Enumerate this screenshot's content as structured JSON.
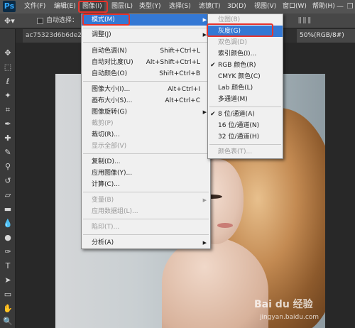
{
  "app": {
    "logo": "Ps"
  },
  "menubar": {
    "items": [
      "文件(F)",
      "编辑(E)",
      "图像(I)",
      "图层(L)",
      "类型(Y)",
      "选择(S)",
      "滤镜(T)",
      "3D(D)",
      "视图(V)",
      "窗口(W)",
      "帮助(H)"
    ],
    "window_controls": [
      "—",
      "❐",
      "✕"
    ]
  },
  "options_bar": {
    "auto_select": "自动选择：",
    "zoom_info": "50%(RGB/8#)"
  },
  "tabs": {
    "doc_name": "ac75323d6b6de24",
    "doc_info": "50%(RGB/8#)",
    "close": "×"
  },
  "image_menu": {
    "items": [
      {
        "label": "模式(M)",
        "shortcut": "",
        "submenu": true,
        "disabled": false
      },
      {
        "label": "调整(J)",
        "shortcut": "",
        "submenu": true,
        "disabled": false
      },
      {
        "label": "自动色调(N)",
        "shortcut": "Shift+Ctrl+L",
        "submenu": false,
        "disabled": false
      },
      {
        "label": "自动对比度(U)",
        "shortcut": "Alt+Shift+Ctrl+L",
        "submenu": false,
        "disabled": false
      },
      {
        "label": "自动颜色(O)",
        "shortcut": "Shift+Ctrl+B",
        "submenu": false,
        "disabled": false
      },
      {
        "label": "图像大小(I)...",
        "shortcut": "Alt+Ctrl+I",
        "submenu": false,
        "disabled": false
      },
      {
        "label": "画布大小(S)...",
        "shortcut": "Alt+Ctrl+C",
        "submenu": false,
        "disabled": false
      },
      {
        "label": "图像旋转(G)",
        "shortcut": "",
        "submenu": true,
        "disabled": false
      },
      {
        "label": "裁剪(P)",
        "shortcut": "",
        "submenu": false,
        "disabled": true
      },
      {
        "label": "裁切(R)...",
        "shortcut": "",
        "submenu": false,
        "disabled": false
      },
      {
        "label": "显示全部(V)",
        "shortcut": "",
        "submenu": false,
        "disabled": true
      },
      {
        "label": "复制(D)...",
        "shortcut": "",
        "submenu": false,
        "disabled": false
      },
      {
        "label": "应用图像(Y)...",
        "shortcut": "",
        "submenu": false,
        "disabled": false
      },
      {
        "label": "计算(C)...",
        "shortcut": "",
        "submenu": false,
        "disabled": false
      },
      {
        "label": "变量(B)",
        "shortcut": "",
        "submenu": true,
        "disabled": true
      },
      {
        "label": "应用数据组(L)...",
        "shortcut": "",
        "submenu": false,
        "disabled": true
      },
      {
        "label": "陷印(T)...",
        "shortcut": "",
        "submenu": false,
        "disabled": true
      },
      {
        "label": "分析(A)",
        "shortcut": "",
        "submenu": true,
        "disabled": false
      }
    ]
  },
  "mode_submenu": {
    "items": [
      {
        "label": "位图(B)",
        "disabled": true,
        "checked": false
      },
      {
        "label": "灰度(G)",
        "disabled": false,
        "checked": false
      },
      {
        "label": "双色调(D)",
        "disabled": true,
        "checked": false
      },
      {
        "label": "索引颜色(I)...",
        "disabled": false,
        "checked": false
      },
      {
        "label": "RGB 颜色(R)",
        "disabled": false,
        "checked": true
      },
      {
        "label": "CMYK 颜色(C)",
        "disabled": false,
        "checked": false
      },
      {
        "label": "Lab 颜色(L)",
        "disabled": false,
        "checked": false
      },
      {
        "label": "多通道(M)",
        "disabled": false,
        "checked": false
      },
      {
        "label": "8 位/通道(A)",
        "disabled": false,
        "checked": true
      },
      {
        "label": "16 位/通道(N)",
        "disabled": false,
        "checked": false
      },
      {
        "label": "32 位/通道(H)",
        "disabled": false,
        "checked": false
      },
      {
        "label": "颜色表(T)...",
        "disabled": true,
        "checked": false
      }
    ]
  },
  "watermark": {
    "logo": "Bai du 经验",
    "url": "jingyan.baidu.com"
  },
  "colors": {
    "highlight": "#3478d4",
    "callout": "#e8332b"
  }
}
